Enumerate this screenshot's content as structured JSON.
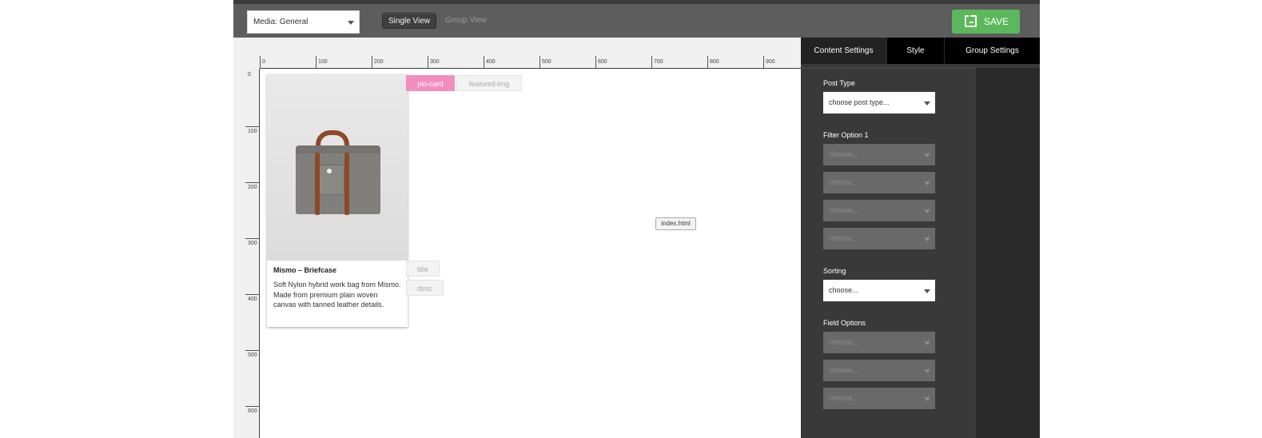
{
  "toolbar": {
    "media_select": "Media: General",
    "single_view": "Single View",
    "group_view": "Group View",
    "save": "SAVE"
  },
  "ruler": {
    "top_ticks": [
      "0",
      "100",
      "200",
      "300",
      "400",
      "500",
      "600",
      "700",
      "800",
      "900"
    ],
    "left_ticks": [
      "0",
      "100",
      "200",
      "300",
      "400",
      "500",
      "600"
    ]
  },
  "canvas": {
    "card": {
      "title": "Mismo – Briefcase",
      "desc": "Soft Nylon hybrid work bag from Mismo. Made from premium plain woven canvas with tanned leather details."
    },
    "tags": {
      "pin_card": "pin-card",
      "featured_img": "featured-img",
      "title": "title",
      "desc": "desc"
    },
    "file_badge": "index.html"
  },
  "panel": {
    "tabs": [
      "Content Settings",
      "Style",
      "Group Settings"
    ],
    "post_type_label": "Post Type",
    "post_type_value": "choose post type...",
    "filter_label": "Filter Option 1",
    "filter_values": [
      "choose...",
      "choose...",
      "choose...",
      "choose..."
    ],
    "sorting_label": "Sorting",
    "sorting_value": "choose...",
    "field_label": "Field Options",
    "field_values": [
      "choose...",
      "choose...",
      "choose..."
    ]
  },
  "colors": {
    "save_green": "#5cb85c",
    "pin_pink": "#f48dbf"
  }
}
